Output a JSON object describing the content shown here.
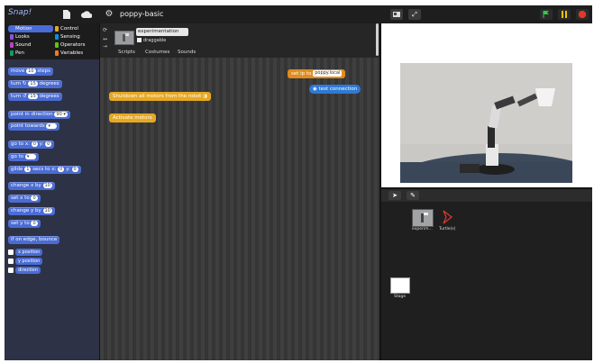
{
  "app": {
    "logo_text": "Snap!"
  },
  "topbar": {
    "project_title": "poppy-basic",
    "icons": {
      "file": "file-icon",
      "cloud": "cloud-icon",
      "settings": "gear-icon",
      "normal_stage": "stage-normal-icon",
      "presentation": "fullscreen-icon",
      "green_flag": "green-flag-icon",
      "pause": "pause-icon",
      "stop": "stop-icon"
    },
    "colors": {
      "flag": "#2ecc40",
      "pause": "#f2c200",
      "stop": "#e0382b"
    }
  },
  "palette": {
    "categories": [
      {
        "label": "Motion",
        "color": "#4a6cd4",
        "selected": true
      },
      {
        "label": "Looks",
        "color": "#8a55d7"
      },
      {
        "label": "Sound",
        "color": "#bb42c3"
      },
      {
        "label": "Pen",
        "color": "#0e9a6c"
      },
      {
        "label": "Control",
        "color": "#e6a823"
      },
      {
        "label": "Sensing",
        "color": "#0494dc"
      },
      {
        "label": "Operators",
        "color": "#62c213"
      },
      {
        "label": "Variables",
        "color": "#ee7d16"
      }
    ],
    "blocks": {
      "move": {
        "pre": "move",
        "slot": "10",
        "post": "steps"
      },
      "turn_cw": {
        "pre": "turn",
        "icon": "↻",
        "slot": "15",
        "post": "degrees"
      },
      "turn_ccw": {
        "pre": "turn",
        "icon": "↺",
        "slot": "15",
        "post": "degrees"
      },
      "point_dir": {
        "pre": "point in direction",
        "slot": "90 ▾"
      },
      "point_towards": {
        "pre": "point towards",
        "slot": "▾"
      },
      "goto_xy": {
        "pre": "go to x:",
        "slot1": "0",
        "mid": "y:",
        "slot2": "0"
      },
      "goto": {
        "pre": "go to",
        "slot": "▾"
      },
      "glide": {
        "pre": "glide",
        "slot1": "1",
        "mid1": "secs to x:",
        "slot2": "0",
        "mid2": "y:",
        "slot3": "0"
      },
      "change_x": {
        "pre": "change x by",
        "slot": "10"
      },
      "set_x": {
        "pre": "set x to",
        "slot": "0"
      },
      "change_y": {
        "pre": "change y by",
        "slot": "10"
      },
      "set_y": {
        "pre": "set y to",
        "slot": "0"
      },
      "bounce": {
        "pre": "if on edge, bounce"
      }
    },
    "reporters": {
      "x_position": "x position",
      "y_position": "y position",
      "direction": "direction"
    }
  },
  "sprite": {
    "name": "experimentation",
    "draggable_label": "draggable",
    "tabs": [
      "Scripts",
      "Costumes",
      "Sounds"
    ]
  },
  "scripts": {
    "hat": {
      "pre": "set",
      "var": "ip",
      "mid": "to",
      "slot": "poppy.local"
    },
    "reporter": "test connection",
    "yellow1": "Shutdown all motors from the robot",
    "yellow2": "Activate motors"
  },
  "corral": {
    "tool_icons": {
      "turtle": "turtle-icon",
      "paint": "paintbrush-icon"
    },
    "sprites": [
      {
        "label": "experim..."
      },
      {
        "label": "Turtle(s)"
      }
    ],
    "stage_label": "Stage"
  }
}
